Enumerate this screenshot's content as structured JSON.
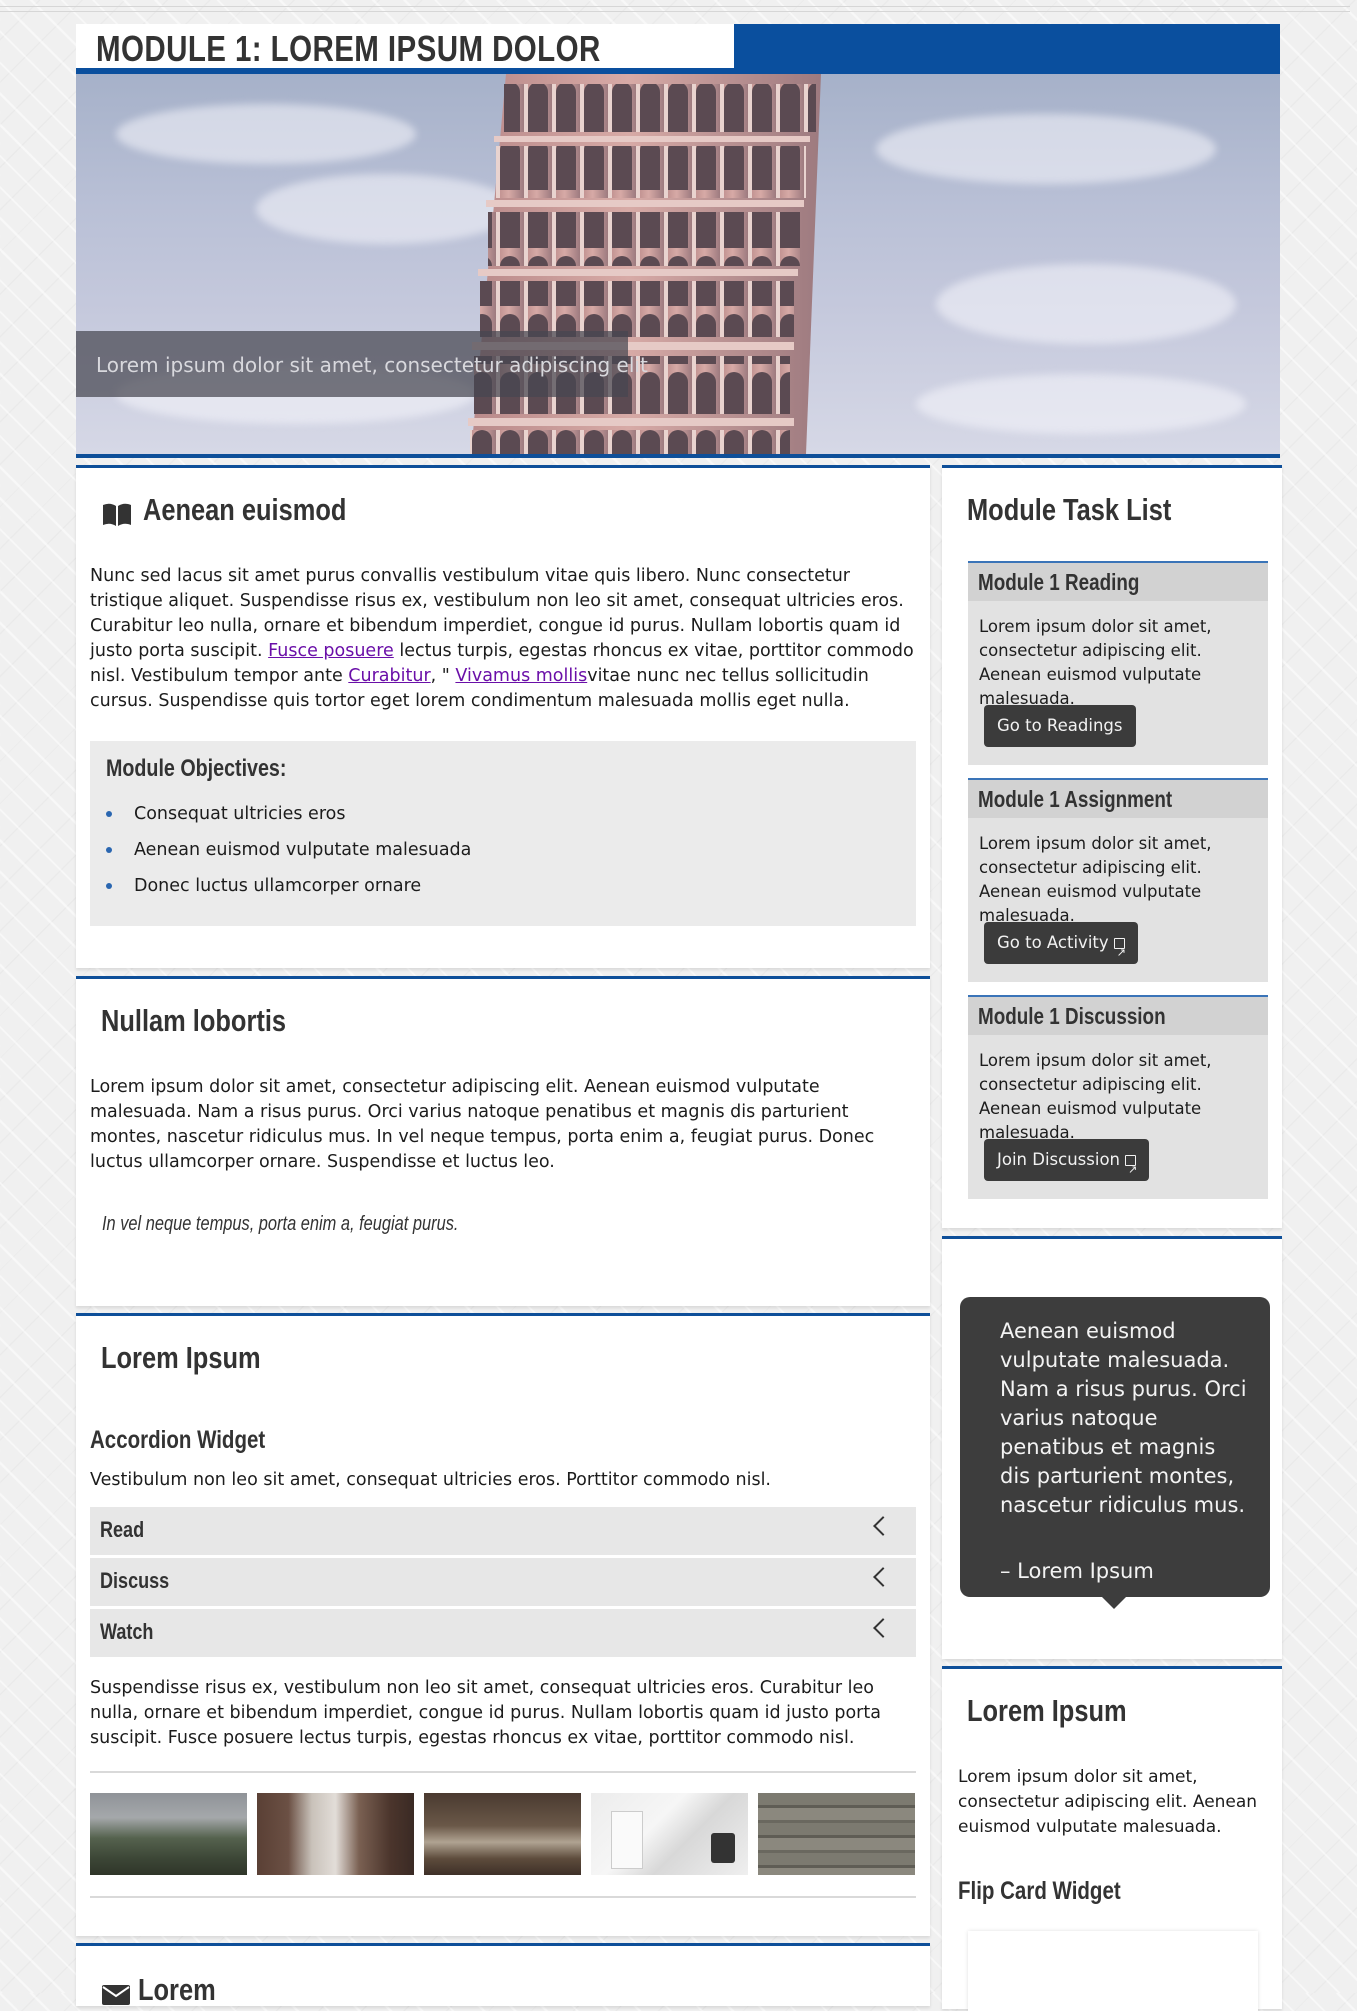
{
  "page": {
    "module_title": "MODULE 1: LOREM IPSUM DOLOR",
    "hero_caption": "Lorem ipsum dolor sit amet, consectetur adipiscing elit"
  },
  "intro_card": {
    "icon": "book-open-icon",
    "heading": "Aenean euismod",
    "para_before_links": "Nunc sed lacus sit amet purus convallis vestibulum vitae quis libero. Nunc consectetur tristique aliquet. Suspendisse risus ex, vestibulum non leo sit amet, consequat ultricies eros. Curabitur leo nulla, ornare et bibendum imperdiet, congue id purus. Nullam lobortis quam id justo porta suscipit. ",
    "link1": "Fusce posuere",
    "para_mid1": " lectus turpis, egestas rhoncus ex vitae, porttitor commodo nisl. Vestibulum tempor ante ",
    "link2": "Curabitur",
    "para_mid2": ", \" ",
    "link3": "Vivamus mollis",
    "para_after": "vitae nunc nec tellus sollicitudin cursus. Suspendisse quis tortor eget lorem condimentum malesuada mollis eget nulla.",
    "objectives": {
      "heading": "Module Objectives:",
      "items": [
        "Consequat ultricies eros",
        "Aenean euismod vulputate malesuada",
        "Donec luctus ullamcorper ornare"
      ]
    }
  },
  "nullam_card": {
    "heading": "Nullam lobortis",
    "paragraph": "Lorem ipsum dolor sit amet, consectetur adipiscing elit. Aenean euismod vulputate malesuada. Nam a risus purus. Orci varius natoque penatibus et magnis dis parturient montes, nascetur ridiculus mus. In vel neque tempus, porta enim a, feugiat purus. Donec luctus ullamcorper ornare. Suspendisse et luctus leo.",
    "pull_quote": "In vel neque tempus, porta enim a, feugiat purus."
  },
  "accordion_card": {
    "heading": "Lorem Ipsum",
    "widget_title": "Accordion Widget",
    "widget_intro": "Vestibulum non leo sit amet, consequat ultricies eros. Porttitor commodo nisl.",
    "items": [
      {
        "label": "Read"
      },
      {
        "label": "Discuss"
      },
      {
        "label": "Watch"
      }
    ],
    "after_text": "Suspendisse risus ex, vestibulum non leo sit amet, consequat ultricies eros. Curabitur leo nulla, ornare et bibendum imperdiet, congue id purus. Nullam lobortis quam id justo porta suscipit. Fusce posuere lectus turpis, egestas rhoncus ex vitae, porttitor commodo nisl.",
    "thumbnails": [
      "green-cliffs-photo",
      "city-alley-photo",
      "shop-interior-photo",
      "product-box-photo",
      "wood-planks-photo"
    ]
  },
  "bottom_card": {
    "icon": "envelope-icon",
    "heading": "Lorem"
  },
  "task_list": {
    "heading": "Module Task List",
    "tasks": [
      {
        "title": "Module 1 Reading",
        "text": "Lorem ipsum dolor sit amet, consectetur adipiscing elit. Aenean euismod vulputate malesuada.",
        "button": "Go to Readings",
        "external": false
      },
      {
        "title": "Module 1 Assignment",
        "text": "Lorem ipsum dolor sit amet, consectetur adipiscing elit. Aenean euismod vulputate malesuada.",
        "button": "Go to Activity",
        "external": true
      },
      {
        "title": "Module 1 Discussion",
        "text": "Lorem ipsum dolor sit amet, consectetur adipiscing elit. Aenean euismod vulputate malesuada.",
        "button": "Join Discussion",
        "external": true
      }
    ]
  },
  "quote_card": {
    "quote": "Aenean euismod vulputate malesuada. Nam a risus purus. Orci varius natoque penatibus et magnis dis parturient montes, nascetur ridiculus mus.",
    "attribution": "– Lorem Ipsum"
  },
  "flip_card": {
    "heading": "Lorem Ipsum",
    "text": "Lorem ipsum dolor sit amet, consectetur adipiscing elit. Aenean euismod vulputate malesuada.",
    "widget_title": "Flip Card Widget"
  },
  "colors": {
    "accent": "#0a4f9e",
    "link": "#6a0fa8",
    "dark_button": "#3b3b3b"
  }
}
